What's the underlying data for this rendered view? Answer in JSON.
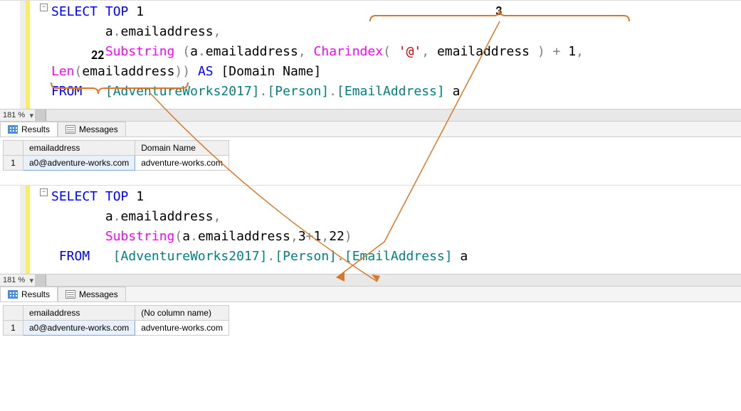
{
  "zoom": "181 %",
  "tabs": {
    "results": "Results",
    "messages": "Messages"
  },
  "annotations": {
    "top_right": "3",
    "top_left": "22"
  },
  "query1": {
    "tokens": {
      "select": "SELECT",
      "top": "TOP",
      "one": "1",
      "a_email": "a",
      "dot1": ".",
      "emailaddress1": "emailaddress",
      "comma1": ",",
      "substring": "Substring",
      "sp": " ",
      "lp1": "(",
      "a2": "a",
      "dot2": ".",
      "email2": "emailaddress",
      "comma2": ",",
      "charindex": "Charindex",
      "lp2": "(",
      "sp2": " ",
      "at": "'@'",
      "comma3": ",",
      "email3": "emailaddress",
      "rp2": ")",
      "plus": "+",
      "one2": "1",
      "comma4": ",",
      "len": "Len",
      "lp3": "(",
      "email4": "emailaddress",
      "rp3": ")",
      "rp4": ")",
      "as": "AS",
      "alias": "[Domain Name]",
      "from": "FROM",
      "tbl": "[AdventureWorks2017]",
      "dot3": ".",
      "schema": "[Person]",
      "dot4": ".",
      "tblname": "[EmailAddress]",
      "a3": "a"
    }
  },
  "results1": {
    "headers": [
      "",
      "emailaddress",
      "Domain Name"
    ],
    "row": [
      "1",
      "a0@adventure-works.com",
      "adventure-works.com"
    ]
  },
  "query2": {
    "tokens": {
      "select": "SELECT",
      "top": "TOP",
      "one": "1",
      "a1": "a",
      "dot1": ".",
      "email1": "emailaddress",
      "comma1": ",",
      "substring": "Substring",
      "lp1": "(",
      "a2": "a",
      "dot2": ".",
      "email2": "emailaddress",
      "comma2": ",",
      "three": "3",
      "plus": "+",
      "one2": "1",
      "comma3": ",",
      "tw2": "22",
      "rp1": ")",
      "from": "FROM",
      "tbl": "[AdventureWorks2017]",
      "dot3": ".",
      "schema": "[Person]",
      "dot4": ".",
      "tblname": "[EmailAddress]",
      "a3": "a"
    }
  },
  "results2": {
    "headers": [
      "",
      "emailaddress",
      "(No column name)"
    ],
    "row": [
      "1",
      "a0@adventure-works.com",
      "adventure-works.com"
    ]
  }
}
